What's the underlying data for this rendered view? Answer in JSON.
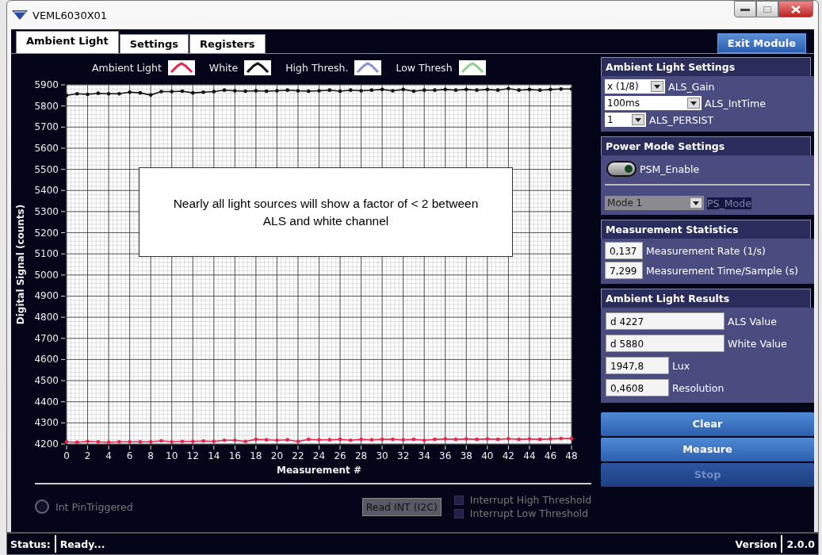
{
  "window": {
    "title": "VEML6030X01"
  },
  "tabs": [
    {
      "label": "Ambient Light",
      "selected": true
    },
    {
      "label": "Settings",
      "selected": false
    },
    {
      "label": "Registers",
      "selected": false
    }
  ],
  "exit_button": {
    "label": "Exit Module"
  },
  "chart": {
    "note": "Nearly all light sources will show a factor of < 2 between ALS and white channel",
    "chart_data": {
      "type": "line",
      "xlabel": "Measurement #",
      "ylabel": "Digital Signal (counts)",
      "grid": true,
      "x": [
        0,
        1,
        2,
        3,
        4,
        5,
        6,
        7,
        8,
        9,
        10,
        11,
        12,
        13,
        14,
        15,
        16,
        17,
        18,
        19,
        20,
        21,
        22,
        23,
        24,
        25,
        26,
        27,
        28,
        29,
        30,
        31,
        32,
        33,
        34,
        35,
        36,
        37,
        38,
        39,
        40,
        41,
        42,
        43,
        44,
        45,
        46,
        47,
        48
      ],
      "series": [
        {
          "name": "Ambient Light",
          "color": "#e8274f",
          "values": [
            4210,
            4208,
            4212,
            4210,
            4208,
            4210,
            4210,
            4210,
            4210,
            4215,
            4210,
            4212,
            4212,
            4214,
            4212,
            4218,
            4218,
            4212,
            4222,
            4220,
            4218,
            4220,
            4212,
            4222,
            4220,
            4220,
            4222,
            4218,
            4222,
            4220,
            4222,
            4222,
            4220,
            4222,
            4218,
            4222,
            4224,
            4222,
            4224,
            4222,
            4224,
            4222,
            4225,
            4222,
            4224,
            4222,
            4224,
            4226,
            4226
          ]
        },
        {
          "name": "White",
          "color": "#111111",
          "values": [
            5850,
            5858,
            5855,
            5860,
            5858,
            5858,
            5865,
            5862,
            5852,
            5868,
            5868,
            5870,
            5862,
            5865,
            5868,
            5875,
            5872,
            5870,
            5872,
            5870,
            5872,
            5875,
            5872,
            5870,
            5872,
            5875,
            5870,
            5875,
            5872,
            5875,
            5878,
            5872,
            5878,
            5870,
            5875,
            5875,
            5878,
            5875,
            5878,
            5875,
            5878,
            5875,
            5882,
            5875,
            5878,
            5875,
            5878,
            5880,
            5880
          ]
        },
        {
          "name": "High Thresh.",
          "color": "#8a8fd0",
          "values": [
            null,
            null,
            null,
            null,
            null,
            null,
            null,
            null,
            null,
            null,
            null,
            null,
            null,
            null,
            null,
            null,
            null,
            null,
            null,
            null,
            null,
            null,
            null,
            null,
            null,
            null,
            null,
            null,
            null,
            null,
            null,
            null,
            null,
            null,
            null,
            null,
            null,
            null,
            null,
            null,
            null,
            null,
            null,
            null,
            null,
            null,
            null,
            null,
            null
          ]
        },
        {
          "name": "Low Thresh",
          "color": "#8fd08a",
          "values": [
            null,
            null,
            null,
            null,
            null,
            null,
            null,
            null,
            null,
            null,
            null,
            null,
            null,
            null,
            null,
            null,
            null,
            null,
            null,
            null,
            null,
            null,
            null,
            null,
            null,
            null,
            null,
            null,
            null,
            null,
            null,
            null,
            null,
            null,
            null,
            null,
            null,
            null,
            null,
            null,
            null,
            null,
            null,
            null,
            null,
            null,
            null,
            null,
            null
          ]
        }
      ],
      "xlim": [
        0,
        48
      ],
      "ylim": [
        4200,
        5900
      ],
      "xticks": [
        0,
        2,
        4,
        6,
        8,
        10,
        12,
        14,
        16,
        18,
        20,
        22,
        24,
        26,
        28,
        30,
        32,
        34,
        36,
        38,
        40,
        42,
        44,
        46,
        48
      ],
      "yticks": [
        4200,
        4300,
        4400,
        4500,
        4600,
        4700,
        4800,
        4900,
        5000,
        5100,
        5200,
        5300,
        5400,
        5500,
        5600,
        5700,
        5800,
        5900
      ]
    }
  },
  "interrupts": {
    "int_pin": {
      "label": "Int PinTriggered",
      "on": false
    },
    "read_button": {
      "label": "Read INT (I2C)"
    },
    "flags": [
      {
        "label": "Interrupt High Threshold",
        "checked": false
      },
      {
        "label": "Interrupt Low Threshold",
        "checked": false
      }
    ]
  },
  "sections": [
    {
      "kind": "dropdowns",
      "title": "Ambient Light Settings",
      "fields": [
        {
          "value": "x (1/8)",
          "label": "ALS_Gain"
        },
        {
          "value": "100ms",
          "label": "ALS_IntTime"
        },
        {
          "value": "1",
          "label": "ALS_PERSIST"
        }
      ]
    },
    {
      "kind": "power",
      "title": "Power Mode Settings",
      "switch": {
        "label": "PSM_Enable",
        "on": true
      },
      "mode": {
        "value": "Mode 1",
        "label": "PS_Mode",
        "disabled": true
      }
    },
    {
      "kind": "readouts",
      "title": "Measurement Statistics",
      "fields": [
        {
          "value": "0,137",
          "label": "Measurement Rate (1/s)"
        },
        {
          "value": "7,299",
          "label": "Measurement Time/Sample (s)"
        }
      ]
    },
    {
      "kind": "readouts",
      "title": "Ambient Light Results",
      "fields": [
        {
          "value": "d 4227",
          "label": "ALS Value"
        },
        {
          "value": "d 5880",
          "label": "White Value"
        },
        {
          "value": "1947,8",
          "label": "Lux"
        },
        {
          "value": "0,4608",
          "label": "Resolution"
        }
      ]
    }
  ],
  "buttons": [
    {
      "label": "Clear",
      "disabled": false
    },
    {
      "label": "Measure",
      "disabled": false
    },
    {
      "label": "Stop",
      "disabled": true
    }
  ],
  "status_bar": {
    "label": "Status:",
    "value": "Ready...",
    "version_label": "Version",
    "version": "2.0.0"
  }
}
